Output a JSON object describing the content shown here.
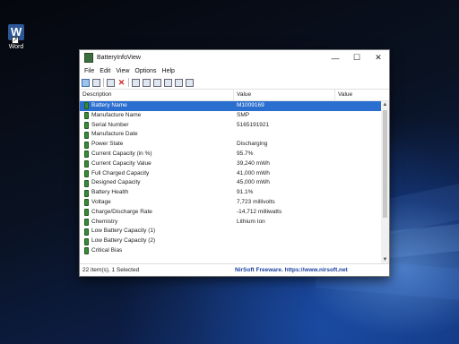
{
  "desktop": {
    "icon_label": "Word",
    "icon_letter": "W"
  },
  "window": {
    "title": "BatteryInfoView",
    "controls": {
      "minimize": "—",
      "maximize": "☐",
      "close": "✕"
    }
  },
  "menu": [
    "File",
    "Edit",
    "View",
    "Options",
    "Help"
  ],
  "columns": [
    "Description",
    "Value",
    "Value"
  ],
  "rows": [
    {
      "name": "Battery Name",
      "value": "M1009169",
      "selected": true
    },
    {
      "name": "Manufacture Name",
      "value": "SMP"
    },
    {
      "name": "Serial Number",
      "value": "5165191921"
    },
    {
      "name": "Manufacture Date",
      "value": ""
    },
    {
      "name": "Power State",
      "value": "Discharging"
    },
    {
      "name": "Current Capacity (in %)",
      "value": "95.7%"
    },
    {
      "name": "Current Capacity Value",
      "value": "39,240 mWh"
    },
    {
      "name": "Full Charged Capacity",
      "value": "41,000 mWh"
    },
    {
      "name": "Designed Capacity",
      "value": "45,000 mWh"
    },
    {
      "name": "Battery Health",
      "value": "91.1%"
    },
    {
      "name": "Voltage",
      "value": "7,723 millivolts"
    },
    {
      "name": "Charge/Discharge Rate",
      "value": "-14,712 milliwatts"
    },
    {
      "name": "Chemistry",
      "value": "Lithium Ion"
    },
    {
      "name": "Low Battery Capacity (1)",
      "value": ""
    },
    {
      "name": "Low Battery Capacity (2)",
      "value": ""
    },
    {
      "name": "Critical Bias",
      "value": ""
    }
  ],
  "status": {
    "items": "22 item(s), 1 Selected",
    "link": "NirSoft Freeware.  https://www.nirsoft.net"
  },
  "colors": {
    "selection": "#2a6fd0",
    "link": "#1a3fa0",
    "battery_icon": "#3a8a3a"
  }
}
